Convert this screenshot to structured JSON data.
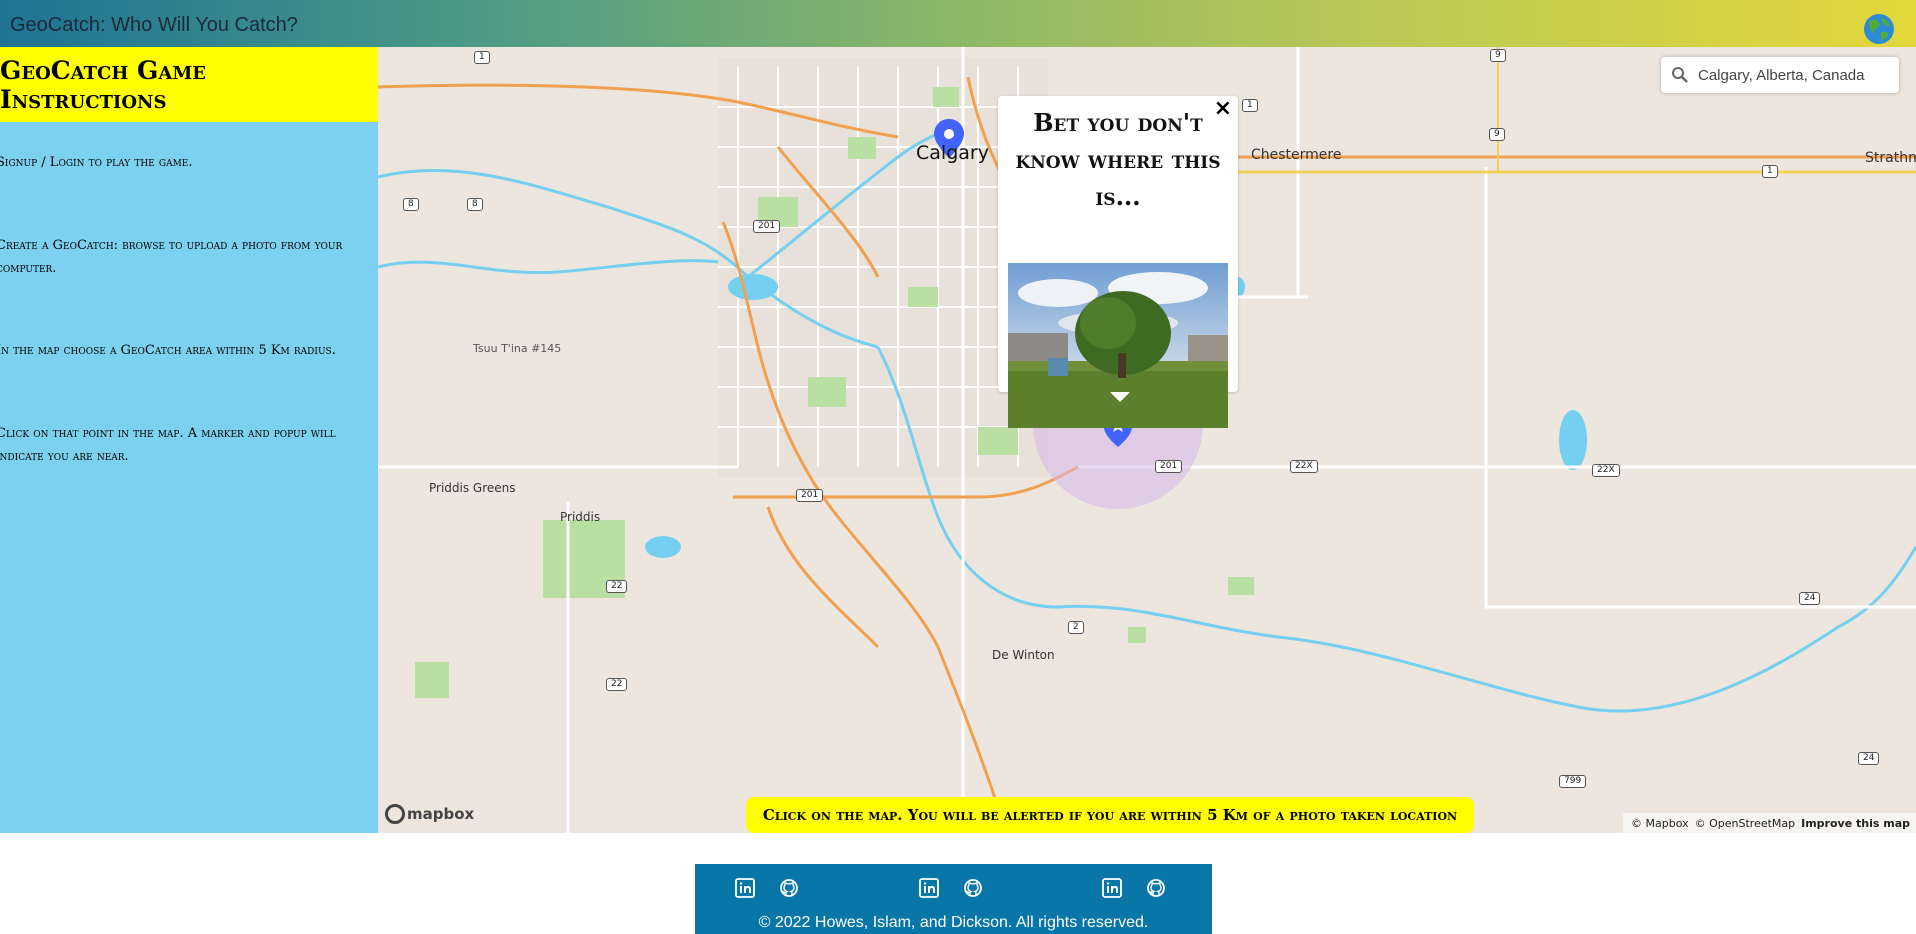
{
  "header": {
    "title": "GeoCatch: Who Will You Catch?",
    "globe_icon": "globe-icon"
  },
  "sidebar": {
    "heading": "GeoCatch Game Instructions",
    "instructions": [
      "Signup / Login to play the game.",
      "Create a GeoCatch: browse to upload a photo from your computer.",
      "In the map choose a GeoCatch area within 5 Km radius.",
      "Click on that point in the map. A marker and popup will indicate you are near."
    ]
  },
  "map": {
    "search": {
      "value": "Calgary, Alberta, Canada",
      "icon": "search-icon"
    },
    "labels": {
      "calgary": "Calgary",
      "chestermere": "Chestermere",
      "strathmore": "Strathm",
      "tsuu_tina": "Tsuu T'ina #145",
      "priddis_greens": "Priddis Greens",
      "priddis": "Priddis",
      "de_winton": "De Winton"
    },
    "shields": {
      "r1a": "1",
      "r9a": "9",
      "r9b": "9",
      "r1b": "1",
      "r1c": "1",
      "r8a": "8",
      "r8b": "8",
      "r201a": "201",
      "r201b": "201",
      "r201c": "201",
      "r22xa": "22X",
      "r22xb": "22X",
      "r22a": "22",
      "r22b": "22",
      "r2": "2",
      "r24a": "24",
      "r24b": "24",
      "r799": "799"
    },
    "popup": {
      "title": "Bet you don't know where this is...",
      "close": "×"
    },
    "alert": "Click on the map. You will be alerted if you are within 5 Km of a photo taken location",
    "logo": "mapbox",
    "attribution": {
      "mapbox": "© Mapbox",
      "osm": "© OpenStreetMap",
      "improve": "Improve this map"
    },
    "colors": {
      "water": "#75cff0",
      "park": "#b9dfa3",
      "highway": "#f0a04f",
      "radius": "#d9b7ea",
      "marker": "#4264fb"
    }
  },
  "footer": {
    "copyright": "© 2022 Howes, Islam, and Dickson. All rights reserved.",
    "icons": [
      "linkedin-icon",
      "github-icon",
      "linkedin-icon",
      "github-icon",
      "linkedin-icon",
      "github-icon"
    ]
  }
}
